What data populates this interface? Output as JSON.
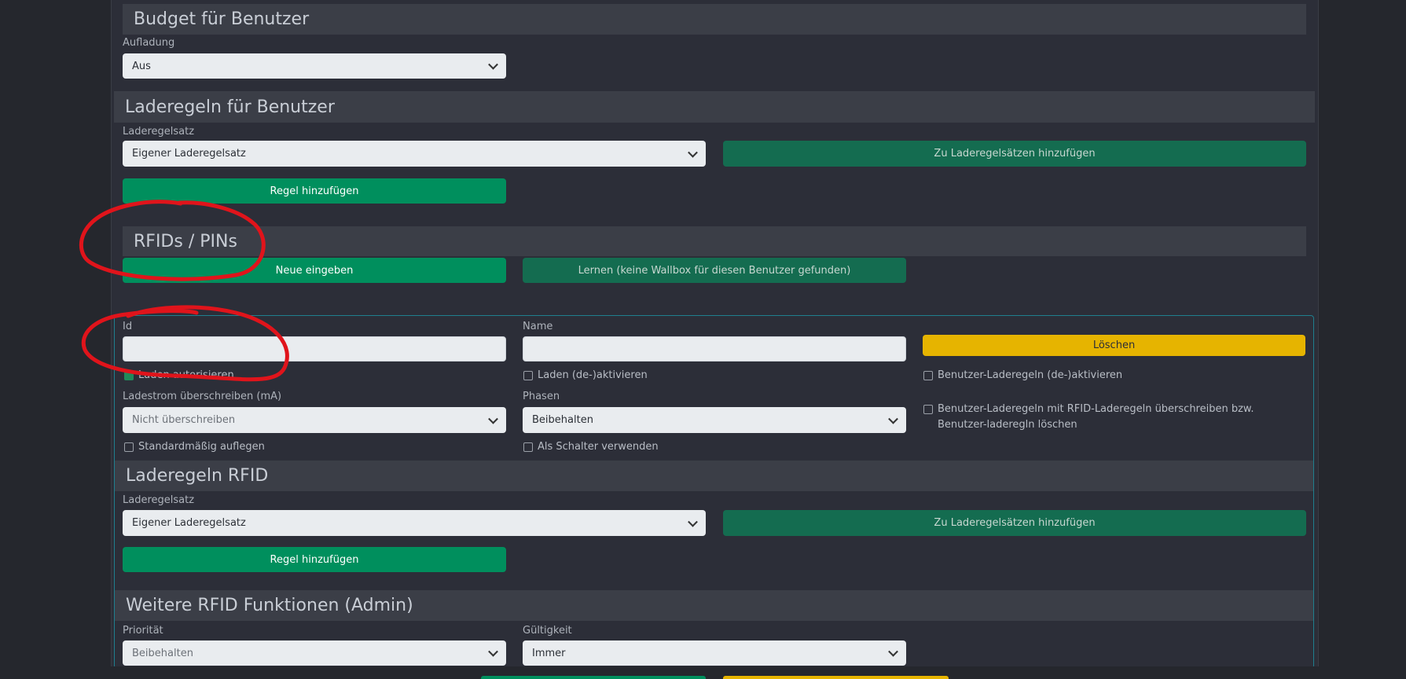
{
  "budget": {
    "title": "Budget für Benutzer",
    "aufladung_label": "Aufladung",
    "aufladung_value": "Aus"
  },
  "laderegeln_user": {
    "title": "Laderegeln für Benutzer",
    "regelsatz_label": "Laderegelsatz",
    "regelsatz_value": "Eigener Laderegelsatz",
    "add_to_sets": "Zu Laderegelsätzen hinzufügen",
    "add_rule": "Regel hinzufügen"
  },
  "rfids": {
    "title": "RFIDs / PINs",
    "new_button": "Neue eingeben",
    "learn_button": "Lernen (keine Wallbox für diesen Benutzer gefunden)"
  },
  "rfid_entry": {
    "id_label": "Id",
    "id_value": "",
    "name_label": "Name",
    "name_value": "",
    "delete_button": "Löschen",
    "auth_label": "Laden autorisieren",
    "auth_checked": true,
    "toggle_charge_label": "Laden (de-)aktivieren",
    "toggle_user_rules_label": "Benutzer-Laderegeln (de-)aktivieren",
    "current_label": "Ladestrom überschreiben (mA)",
    "current_value": "Nicht überschreiben",
    "phases_label": "Phasen",
    "phases_value": "Beibehalten",
    "override_rules_label": "Benutzer-Laderegeln mit RFID-Laderegeln überschreiben bzw. Benutzer-laderegln löschen",
    "default_hangup_label": "Standardmäßig auflegen",
    "as_switch_label": "Als Schalter verwenden"
  },
  "laderegeln_rfid": {
    "title": "Laderegeln RFID",
    "regelsatz_label": "Laderegelsatz",
    "regelsatz_value": "Eigener Laderegelsatz",
    "add_to_sets": "Zu Laderegelsätzen hinzufügen",
    "add_rule": "Regel hinzufügen"
  },
  "weitere": {
    "title": "Weitere RFID Funktionen (Admin)",
    "prioritaet_label": "Priorität",
    "prioritaet_value": "Beibehalten",
    "gueltigkeit_label": "Gültigkeit",
    "gueltigkeit_value": "Immer"
  },
  "colors": {
    "annotation": "#e0141b",
    "primary_green": "#008f5d",
    "dark_green": "#146c50",
    "warning": "#e6b400"
  }
}
